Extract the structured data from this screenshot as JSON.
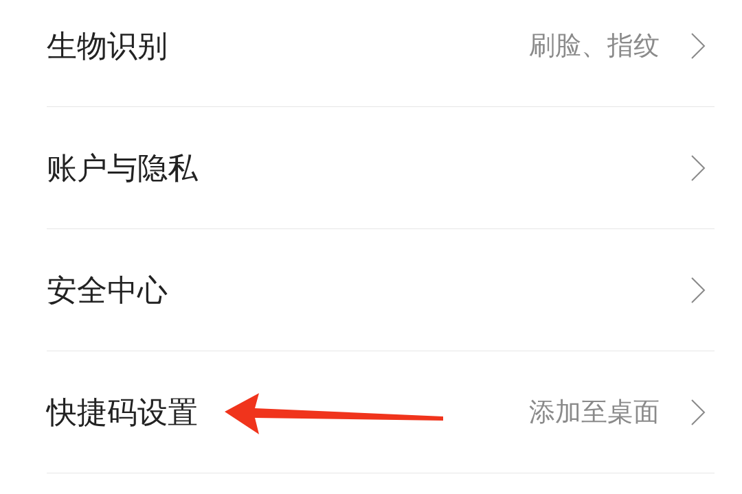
{
  "settings": [
    {
      "label": "生物识别",
      "value": "刷脸、指纹"
    },
    {
      "label": "账户与隐私"
    },
    {
      "label": "安全中心"
    },
    {
      "label": "快捷码设置",
      "value": "添加至桌面",
      "highlighted": true
    }
  ]
}
